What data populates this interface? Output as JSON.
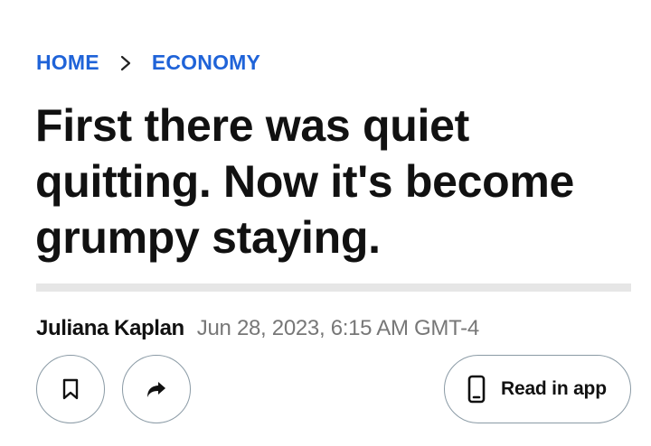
{
  "breadcrumb": {
    "items": [
      {
        "label": "HOME",
        "icon": "none"
      },
      {
        "label": "ECONOMY",
        "icon": "none"
      }
    ],
    "separator_icon": "chevron-right-icon",
    "link_color": "#1f63d8"
  },
  "article": {
    "headline": "First there was quiet quitting. Now it's become grumpy staying.",
    "author": "Juliana Kaplan",
    "timestamp": "Jun 28, 2023, 6:15 AM GMT-4"
  },
  "actions": {
    "bookmark_icon": "bookmark-icon",
    "share_icon": "share-arrow-icon",
    "read_in_app_label": "Read in app",
    "read_in_app_icon": "phone-icon"
  }
}
